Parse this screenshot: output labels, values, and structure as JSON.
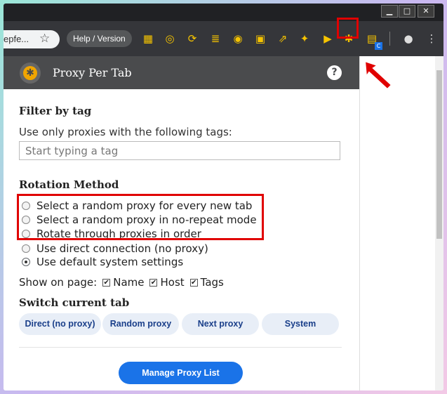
{
  "browser": {
    "omnibox_text": "epfe...",
    "star_icon": "☆",
    "help_version_label": "Help / Version",
    "window_controls": {
      "minimize": "▁",
      "maximize": "□",
      "close": "✕"
    },
    "extension_icons": [
      {
        "name": "ext-1-icon",
        "glyph": "▦"
      },
      {
        "name": "ext-2-icon",
        "glyph": "◎"
      },
      {
        "name": "ext-3-icon",
        "glyph": "⟳"
      },
      {
        "name": "ext-4-icon",
        "glyph": "≣"
      },
      {
        "name": "ext-eye-icon",
        "glyph": "◉"
      },
      {
        "name": "ext-5-icon",
        "glyph": "▣"
      },
      {
        "name": "ext-6-icon",
        "glyph": "⇗"
      },
      {
        "name": "ext-7-icon",
        "glyph": "✦"
      },
      {
        "name": "ext-play-icon",
        "glyph": "▶"
      },
      {
        "name": "proxy-per-tab-icon",
        "glyph": "✱"
      },
      {
        "name": "ext-8-icon",
        "glyph": "▤"
      }
    ],
    "badge_text": "C",
    "profile_icon": "●",
    "menu_icon": "⋮"
  },
  "popup": {
    "title": "Proxy Per Tab",
    "help_icon": "?",
    "filter": {
      "heading": "Filter by tag",
      "description": "Use only proxies with the following tags:",
      "placeholder": "Start typing a tag"
    },
    "rotation": {
      "heading": "Rotation Method",
      "options": [
        {
          "label": "Select a random proxy for every new tab",
          "checked": false
        },
        {
          "label": "Select a random proxy in no-repeat mode",
          "checked": false
        },
        {
          "label": "Rotate through proxies in order",
          "checked": false
        },
        {
          "label": "Use direct connection (no proxy)",
          "checked": false
        },
        {
          "label": "Use default system settings",
          "checked": true
        }
      ]
    },
    "show_on_page": {
      "label": "Show on page:",
      "options": [
        {
          "label": "Name",
          "checked": true
        },
        {
          "label": "Host",
          "checked": true
        },
        {
          "label": "Tags",
          "checked": true
        }
      ]
    },
    "switch": {
      "heading": "Switch current tab",
      "buttons": [
        "Direct (no proxy)",
        "Random proxy",
        "Next proxy",
        "System"
      ]
    },
    "manage_label": "Manage Proxy List"
  },
  "colors": {
    "highlight": "#e00000",
    "accent": "#1a73e8"
  }
}
